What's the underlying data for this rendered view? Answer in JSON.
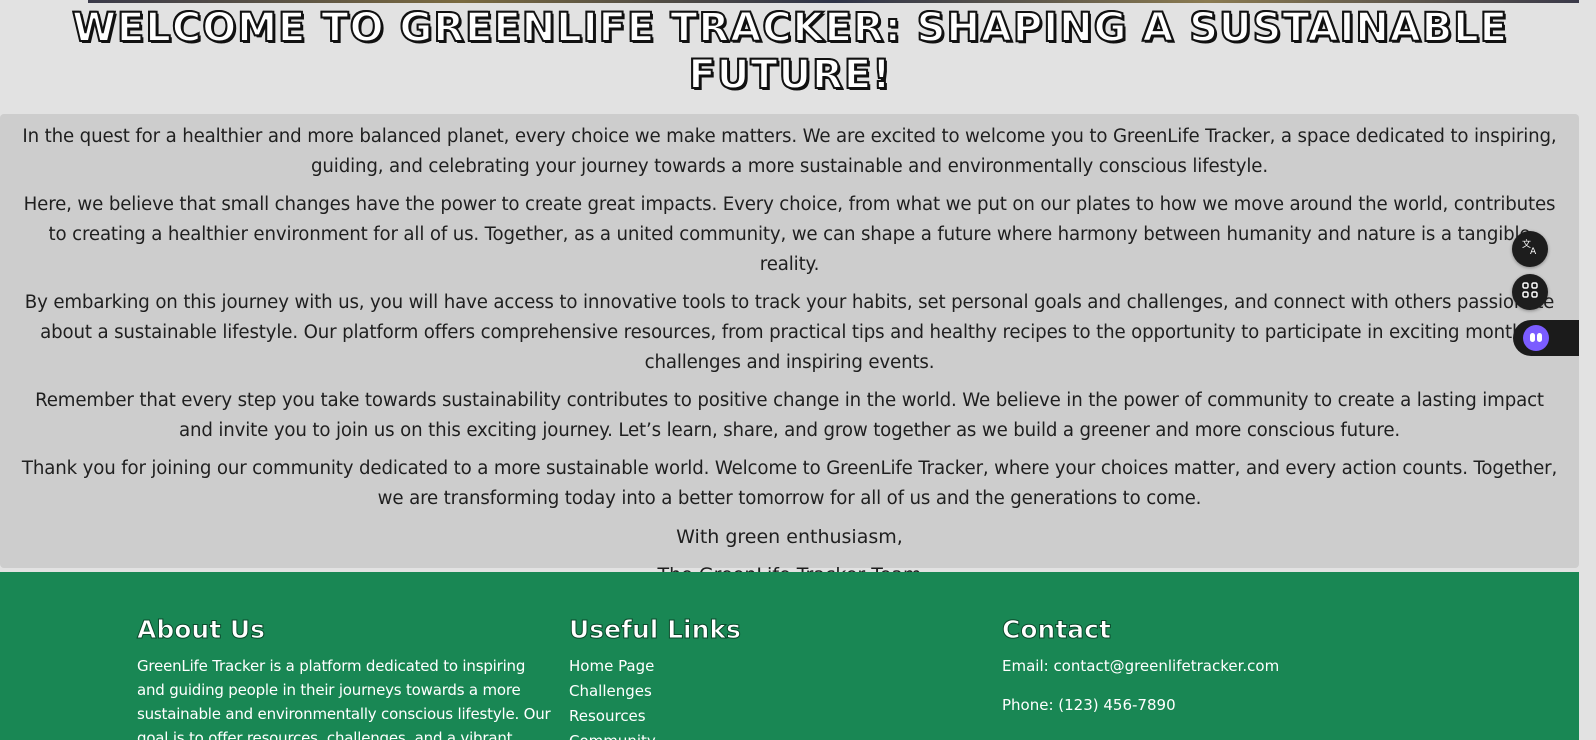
{
  "hero": {
    "title": "WELCOME TO GREENLIFE TRACKER: SHAPING A SUSTAINABLE FUTURE!"
  },
  "welcome": {
    "paragraphs": [
      "In the quest for a healthier and more balanced planet, every choice we make matters. We are excited to welcome you to GreenLife Tracker, a space dedicated to inspiring, guiding, and celebrating your journey towards a more sustainable and environmentally conscious lifestyle.",
      "Here, we believe that small changes have the power to create great impacts. Every choice, from what we put on our plates to how we move around the world, contributes to creating a healthier environment for all of us. Together, as a united community, we can shape a future where harmony between humanity and nature is a tangible reality.",
      "By embarking on this journey with us, you will have access to innovative tools to track your habits, set personal goals and challenges, and connect with others passionate about a sustainable lifestyle. Our platform offers comprehensive resources, from practical tips and healthy recipes to the opportunity to participate in exciting monthly challenges and inspiring events.",
      "Remember that every step you take towards sustainability contributes to positive change in the world. We believe in the power of community to create a lasting impact and invite you to join us on this exciting journey. Let’s learn, share, and grow together as we build a greener and more conscious future.",
      "Thank you for joining our community dedicated to a more sustainable world. Welcome to GreenLife Tracker, where your choices matter, and every action counts. Together, we are transforming today into a better tomorrow for all of us and the generations to come."
    ],
    "closing": "With green enthusiasm,",
    "signature": "The GreenLife Tracker Team"
  },
  "footer": {
    "about": {
      "heading": "About Us",
      "text": "GreenLife Tracker is a platform dedicated to inspiring and guiding people in their journeys towards a more sustainable and environmentally conscious lifestyle. Our goal is to offer resources, challenges, and a vibrant community to support"
    },
    "links": {
      "heading": "Useful Links",
      "items": [
        "Home Page",
        "Challenges",
        "Resources",
        "Community"
      ]
    },
    "contact": {
      "heading": "Contact",
      "email": "Email: contact@greenlifetracker.com",
      "phone": "Phone: (123) 456-7890"
    }
  },
  "floating_tools": {
    "translate_icon": "translate-icon",
    "apps_icon": "apps-grid-icon",
    "assistant_icon": "assistant-bot-icon"
  },
  "colors": {
    "page_background": "#e2e2e2",
    "welcome_box": "#cdcdcd",
    "footer_green": "#198754",
    "text_dark": "#1f1f1f"
  }
}
